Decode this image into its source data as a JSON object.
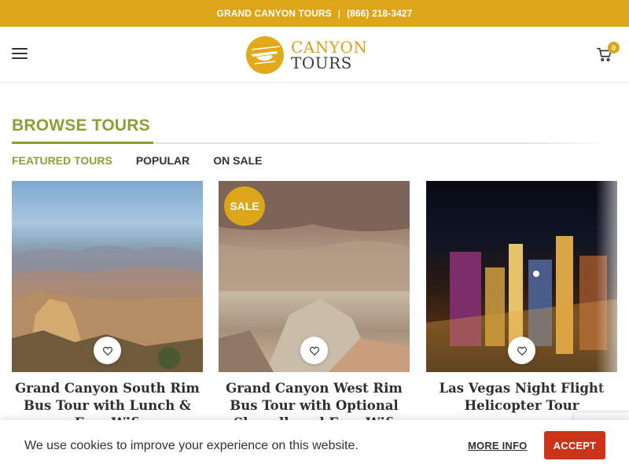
{
  "topbar": {
    "brand": "GRAND CANYON TOURS",
    "separator": "|",
    "phone": "(866) 218-3427"
  },
  "header": {
    "logo_line1": "CANYON",
    "logo_line2": "TOURS",
    "cart_count": "0",
    "menu_icon": "hamburger-icon",
    "cart_icon": "shopping-cart-icon"
  },
  "section": {
    "title": "BROWSE TOURS",
    "tabs": [
      {
        "label": "FEATURED TOURS",
        "active": true
      },
      {
        "label": "POPULAR",
        "active": false
      },
      {
        "label": "ON SALE",
        "active": false
      }
    ]
  },
  "products": [
    {
      "title": "Grand Canyon South Rim Bus Tour with Lunch & Free Wifi",
      "badge": ""
    },
    {
      "title": "Grand Canyon West Rim Bus Tour with Optional Skywalk and Free Wifi",
      "badge": "SALE"
    },
    {
      "title": "Las Vegas Night Flight Helicopter Tour",
      "badge": ""
    }
  ],
  "cookie": {
    "text": "We use cookies to improve your experience on this website.",
    "more_info": "MORE INFO",
    "accept": "ACCEPT"
  },
  "colors": {
    "brand_gold": "#dda619",
    "heading_green": "#8b9f39",
    "accept_red": "#cc3419"
  }
}
